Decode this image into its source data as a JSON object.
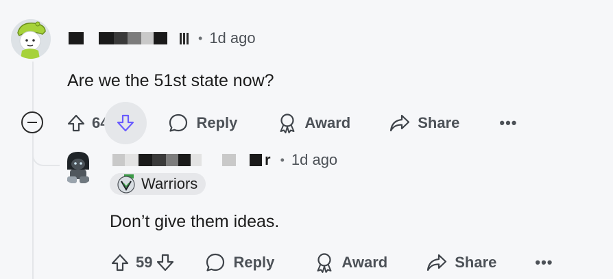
{
  "comment": {
    "author_redacted": true,
    "time": "1d ago",
    "text": "Are we the 51st state now?",
    "score": "64",
    "actions": {
      "reply": "Reply",
      "award": "Award",
      "share": "Share",
      "more": "•••"
    }
  },
  "reply": {
    "author_tail": "r",
    "time": "1d ago",
    "flair": "Warriors",
    "text": "Don’t give them ideas.",
    "score": "59",
    "actions": {
      "reply": "Reply",
      "award": "Award",
      "share": "Share",
      "more": "•••"
    }
  },
  "colors": {
    "background": "#f6f7f9",
    "downvote_accent": "#6a5cff",
    "muted_text": "#4c5157"
  },
  "icons": [
    "collapse-icon",
    "upvote-icon",
    "downvote-icon",
    "comment-bubble-icon",
    "award-icon",
    "share-arrow-icon",
    "flair-logo-icon"
  ]
}
